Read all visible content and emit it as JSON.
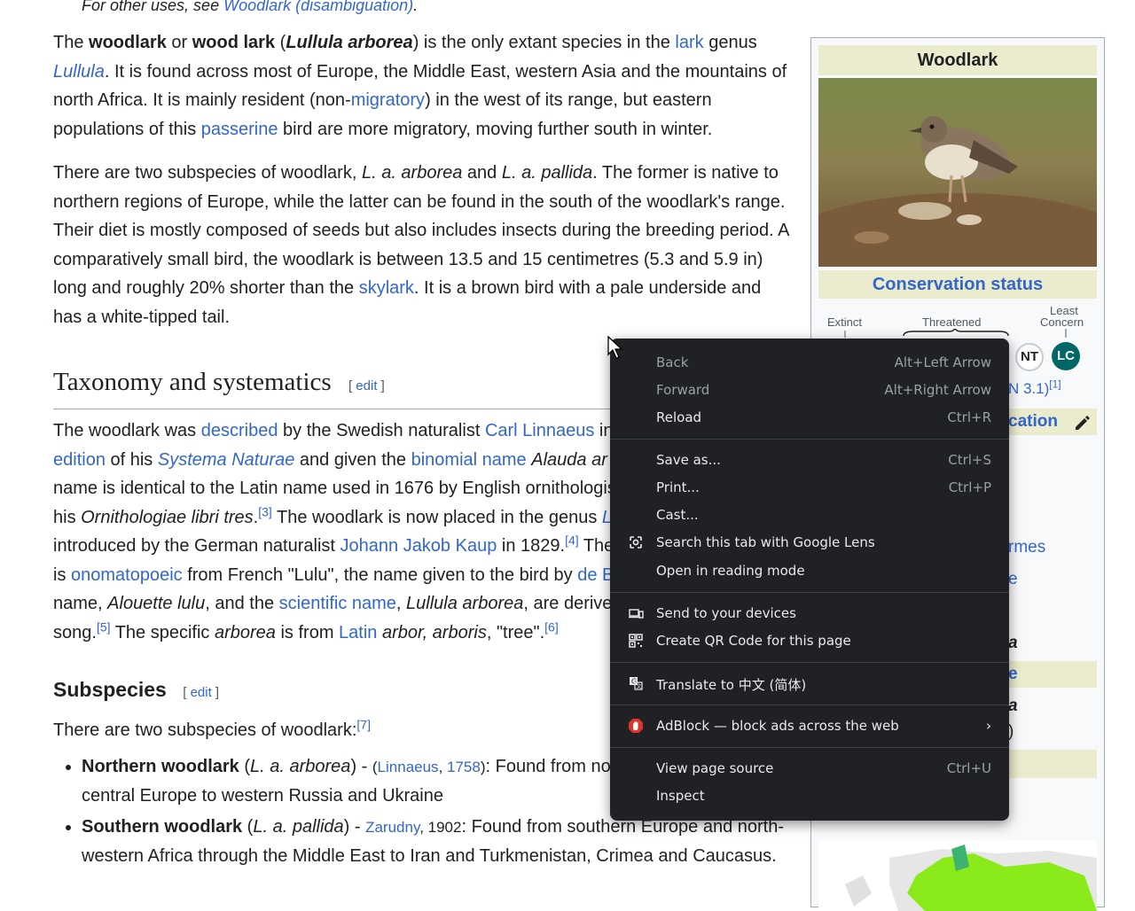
{
  "hatnote": {
    "prefix": "For other uses, see ",
    "link": "Woodlark (disambiguation)",
    "suffix": "."
  },
  "intro": {
    "p1": [
      {
        "t": "The ",
        "s": "n"
      },
      {
        "t": "woodlark",
        "s": "b"
      },
      {
        "t": " or ",
        "s": "n"
      },
      {
        "t": "wood lark",
        "s": "b"
      },
      {
        "t": " (",
        "s": "n"
      },
      {
        "t": "Lullula arborea",
        "s": "bi"
      },
      {
        "t": ") is the only extant species in the ",
        "s": "n"
      },
      {
        "t": "lark",
        "s": "a"
      },
      {
        "t": " genus ",
        "s": "n"
      },
      {
        "t": "Lullula",
        "s": "ai"
      },
      {
        "t": ". It is found across most of Europe, the Middle East, western Asia and the mountains of north Africa. It is mainly resident (non-",
        "s": "n"
      },
      {
        "t": "migratory",
        "s": "a"
      },
      {
        "t": ") in the west of its range, but eastern populations of this ",
        "s": "n"
      },
      {
        "t": "passerine",
        "s": "a"
      },
      {
        "t": " bird are more migratory, moving further south in winter.",
        "s": "n"
      }
    ],
    "p2": [
      {
        "t": "There are two subspecies of woodlark, ",
        "s": "n"
      },
      {
        "t": "L. a. arborea",
        "s": "i"
      },
      {
        "t": " and ",
        "s": "n"
      },
      {
        "t": "L. a. pallida",
        "s": "i"
      },
      {
        "t": ". The former is native to northern regions of Europe, while the latter can be found in the south of the woodlark's range. Their diet is mostly composed of seeds but also includes insects during the breeding period. A comparatively small bird, the woodlark is between 13.5 and 15 centimetres (5.3 and 5.9 in) long and roughly 20% shorter than the ",
        "s": "n"
      },
      {
        "t": "skylark",
        "s": "a"
      },
      {
        "t": ". It is a brown bird with a pale underside and has a white-tipped tail.",
        "s": "n"
      }
    ]
  },
  "taxonomy": {
    "heading": "Taxonomy and systematics",
    "edit_open": "[ ",
    "edit": "edit",
    "edit_close": " ]",
    "p1": [
      {
        "t": "The woodlark was ",
        "s": "n"
      },
      {
        "t": "described",
        "s": "a"
      },
      {
        "t": " by the Swedish naturalist ",
        "s": "n"
      },
      {
        "t": "Carl Linnaeus",
        "s": "a"
      },
      {
        "t": " in",
        "s": "n"
      },
      {
        "t": " ",
        "s": "n"
      },
      {
        "t": "edition",
        "s": "a"
      },
      {
        "t": " of his ",
        "s": "n"
      },
      {
        "t": "Systema Naturae",
        "s": "ai"
      },
      {
        "t": " and given the ",
        "s": "n"
      },
      {
        "t": "binomial name",
        "s": "a"
      },
      {
        "t": " ",
        "s": "n"
      },
      {
        "t": "Alauda ar",
        "s": "i"
      },
      {
        "t": " name is identical to the Latin name used in 1676 by English ornithologis",
        "s": "n"
      },
      {
        "t": " his ",
        "s": "n"
      },
      {
        "t": "Ornithologiae libri tres",
        "s": "i"
      },
      {
        "t": ".",
        "s": "n"
      },
      {
        "t": "[3]",
        "s": "sup"
      },
      {
        "t": " The woodlark is now placed in the genus ",
        "s": "n"
      },
      {
        "t": "L",
        "s": "ai"
      },
      {
        "t": " introduced by the German naturalist ",
        "s": "n"
      },
      {
        "t": "Johann Jakob Kaup",
        "s": "a"
      },
      {
        "t": " in 1829.",
        "s": "n"
      },
      {
        "t": "[4]",
        "s": "sup"
      },
      {
        "t": " The",
        "s": "n"
      },
      {
        "t": " is ",
        "s": "n"
      },
      {
        "t": "onomatopoeic",
        "s": "a"
      },
      {
        "t": " from French \"Lulu\", the name given to the bird by ",
        "s": "n"
      },
      {
        "t": "de B",
        "s": "a"
      },
      {
        "t": " name, ",
        "s": "n"
      },
      {
        "t": "Alouette lulu",
        "s": "i"
      },
      {
        "t": ", and the ",
        "s": "n"
      },
      {
        "t": "scientific name",
        "s": "a"
      },
      {
        "t": ", ",
        "s": "n"
      },
      {
        "t": "Lullula arborea",
        "s": "i"
      },
      {
        "t": ", are derive",
        "s": "n"
      },
      {
        "t": " song.",
        "s": "n"
      },
      {
        "t": "[5]",
        "s": "sup"
      },
      {
        "t": " The specific ",
        "s": "n"
      },
      {
        "t": "arborea",
        "s": "i"
      },
      {
        "t": " is from ",
        "s": "n"
      },
      {
        "t": "Latin",
        "s": "a"
      },
      {
        "t": " ",
        "s": "n"
      },
      {
        "t": "arbor, arboris",
        "s": "i"
      },
      {
        "t": ", \"tree\".",
        "s": "n"
      },
      {
        "t": "[6]",
        "s": "sup"
      }
    ]
  },
  "subspecies": {
    "heading": "Subspecies",
    "edit_open": "[ ",
    "edit": "edit",
    "edit_close": " ]",
    "intro": "There are two subspecies of woodlark:",
    "intro_ref": "[7]",
    "items": [
      {
        "name": "Northern woodlark",
        "sci": "L. a. arborea",
        "auth": "Linnaeus",
        "year": "1758",
        "text_a": ": Found from no",
        "text_b": "central Europe to western Russia and Ukraine"
      },
      {
        "name": "Southern woodlark",
        "sci": "L. a. pallida",
        "auth": "Zarudny",
        "year": "1902",
        "text_a": ": Found from southern Europe and north-",
        "text_b": "western Africa through the Middle East to Iran and Turkmenistan, Crimea and Caucasus."
      }
    ]
  },
  "infobox": {
    "title": "Woodlark",
    "conservation_heading": "Conservation status",
    "scale": {
      "extinct": "Extinct",
      "threatened": "Threatened",
      "least_line1": "Least",
      "least_line2": "Concern"
    },
    "badges": [
      {
        "code": "NT"
      },
      {
        "code": "LC"
      }
    ],
    "iucn_fragment": "N 3.1)",
    "iucn_ref": "[1]",
    "class_fragment": "cation",
    "frag_rmes": "rmes",
    "frag_e1": "e",
    "frag_a1": "a",
    "frag_e2": "e",
    "frag_a2": "a",
    "frag_paren": ")"
  },
  "context_menu": {
    "items": [
      {
        "label": "Back",
        "shortcut": "Alt+Left Arrow",
        "disabled": true,
        "name": "back"
      },
      {
        "label": "Forward",
        "shortcut": "Alt+Right Arrow",
        "disabled": true,
        "name": "forward"
      },
      {
        "label": "Reload",
        "shortcut": "Ctrl+R",
        "disabled": false,
        "name": "reload"
      },
      {
        "label": "Save as...",
        "shortcut": "Ctrl+S",
        "disabled": false,
        "name": "save-as"
      },
      {
        "label": "Print...",
        "shortcut": "Ctrl+P",
        "disabled": false,
        "name": "print"
      },
      {
        "label": "Cast...",
        "shortcut": "",
        "disabled": false,
        "name": "cast"
      },
      {
        "label": "Search this tab with Google Lens",
        "shortcut": "",
        "disabled": false,
        "name": "google-lens",
        "icon": "lens-icon"
      },
      {
        "label": "Open in reading mode",
        "shortcut": "",
        "disabled": false,
        "name": "reading-mode"
      },
      {
        "label": "Send to your devices",
        "shortcut": "",
        "disabled": false,
        "name": "send-to-devices",
        "icon": "devices-icon"
      },
      {
        "label": "Create QR Code for this page",
        "shortcut": "",
        "disabled": false,
        "name": "qr-code",
        "icon": "qr-icon"
      },
      {
        "label": "Translate to 中文 (简体)",
        "shortcut": "",
        "disabled": false,
        "name": "translate",
        "icon": "translate-icon"
      },
      {
        "label": "AdBlock — block ads across the web",
        "shortcut": "›",
        "disabled": false,
        "name": "adblock",
        "icon": "adblock-icon"
      },
      {
        "label": "View page source",
        "shortcut": "Ctrl+U",
        "disabled": false,
        "name": "view-source"
      },
      {
        "label": "Inspect",
        "shortcut": "",
        "disabled": false,
        "name": "inspect"
      }
    ]
  },
  "colors": {
    "link": "#3366cc",
    "menu_bg": "#202124",
    "infobox_header": "#ebebcd",
    "lc_badge": "#006666",
    "adblock_red": "#e0332c"
  }
}
